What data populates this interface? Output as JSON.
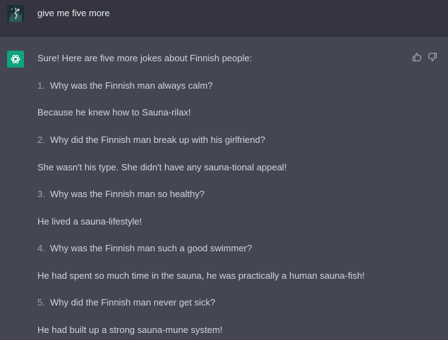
{
  "user_message": "give me five more",
  "assistant": {
    "intro": "Sure! Here are five more jokes about Finnish people:",
    "jokes": [
      {
        "num": "1.",
        "question": "Why was the Finnish man always calm?",
        "answer": "Because he knew how to Sauna-rilax!"
      },
      {
        "num": "2.",
        "question": "Why did the Finnish man break up with his girlfriend?",
        "answer": "She wasn't his type. She didn't have any sauna-tional appeal!"
      },
      {
        "num": "3.",
        "question": "Why was the Finnish man so healthy?",
        "answer": "He lived a sauna-lifestyle!"
      },
      {
        "num": "4.",
        "question": "Why was the Finnish man such a good swimmer?",
        "answer": "He had spent so much time in the sauna, he was practically a human sauna-fish!"
      },
      {
        "num": "5.",
        "question": "Why did the Finnish man never get sick?",
        "answer": "He had built up a strong sauna-mune system!"
      }
    ]
  },
  "icons": {
    "user_avatar": "user-avatar-image",
    "bot_avatar": "openai-logo-icon",
    "thumbs_up": "thumbs-up-icon",
    "thumbs_down": "thumbs-down-icon"
  },
  "colors": {
    "user_bg": "#343541",
    "assistant_bg": "#444654",
    "brand_green": "#10a37f"
  }
}
